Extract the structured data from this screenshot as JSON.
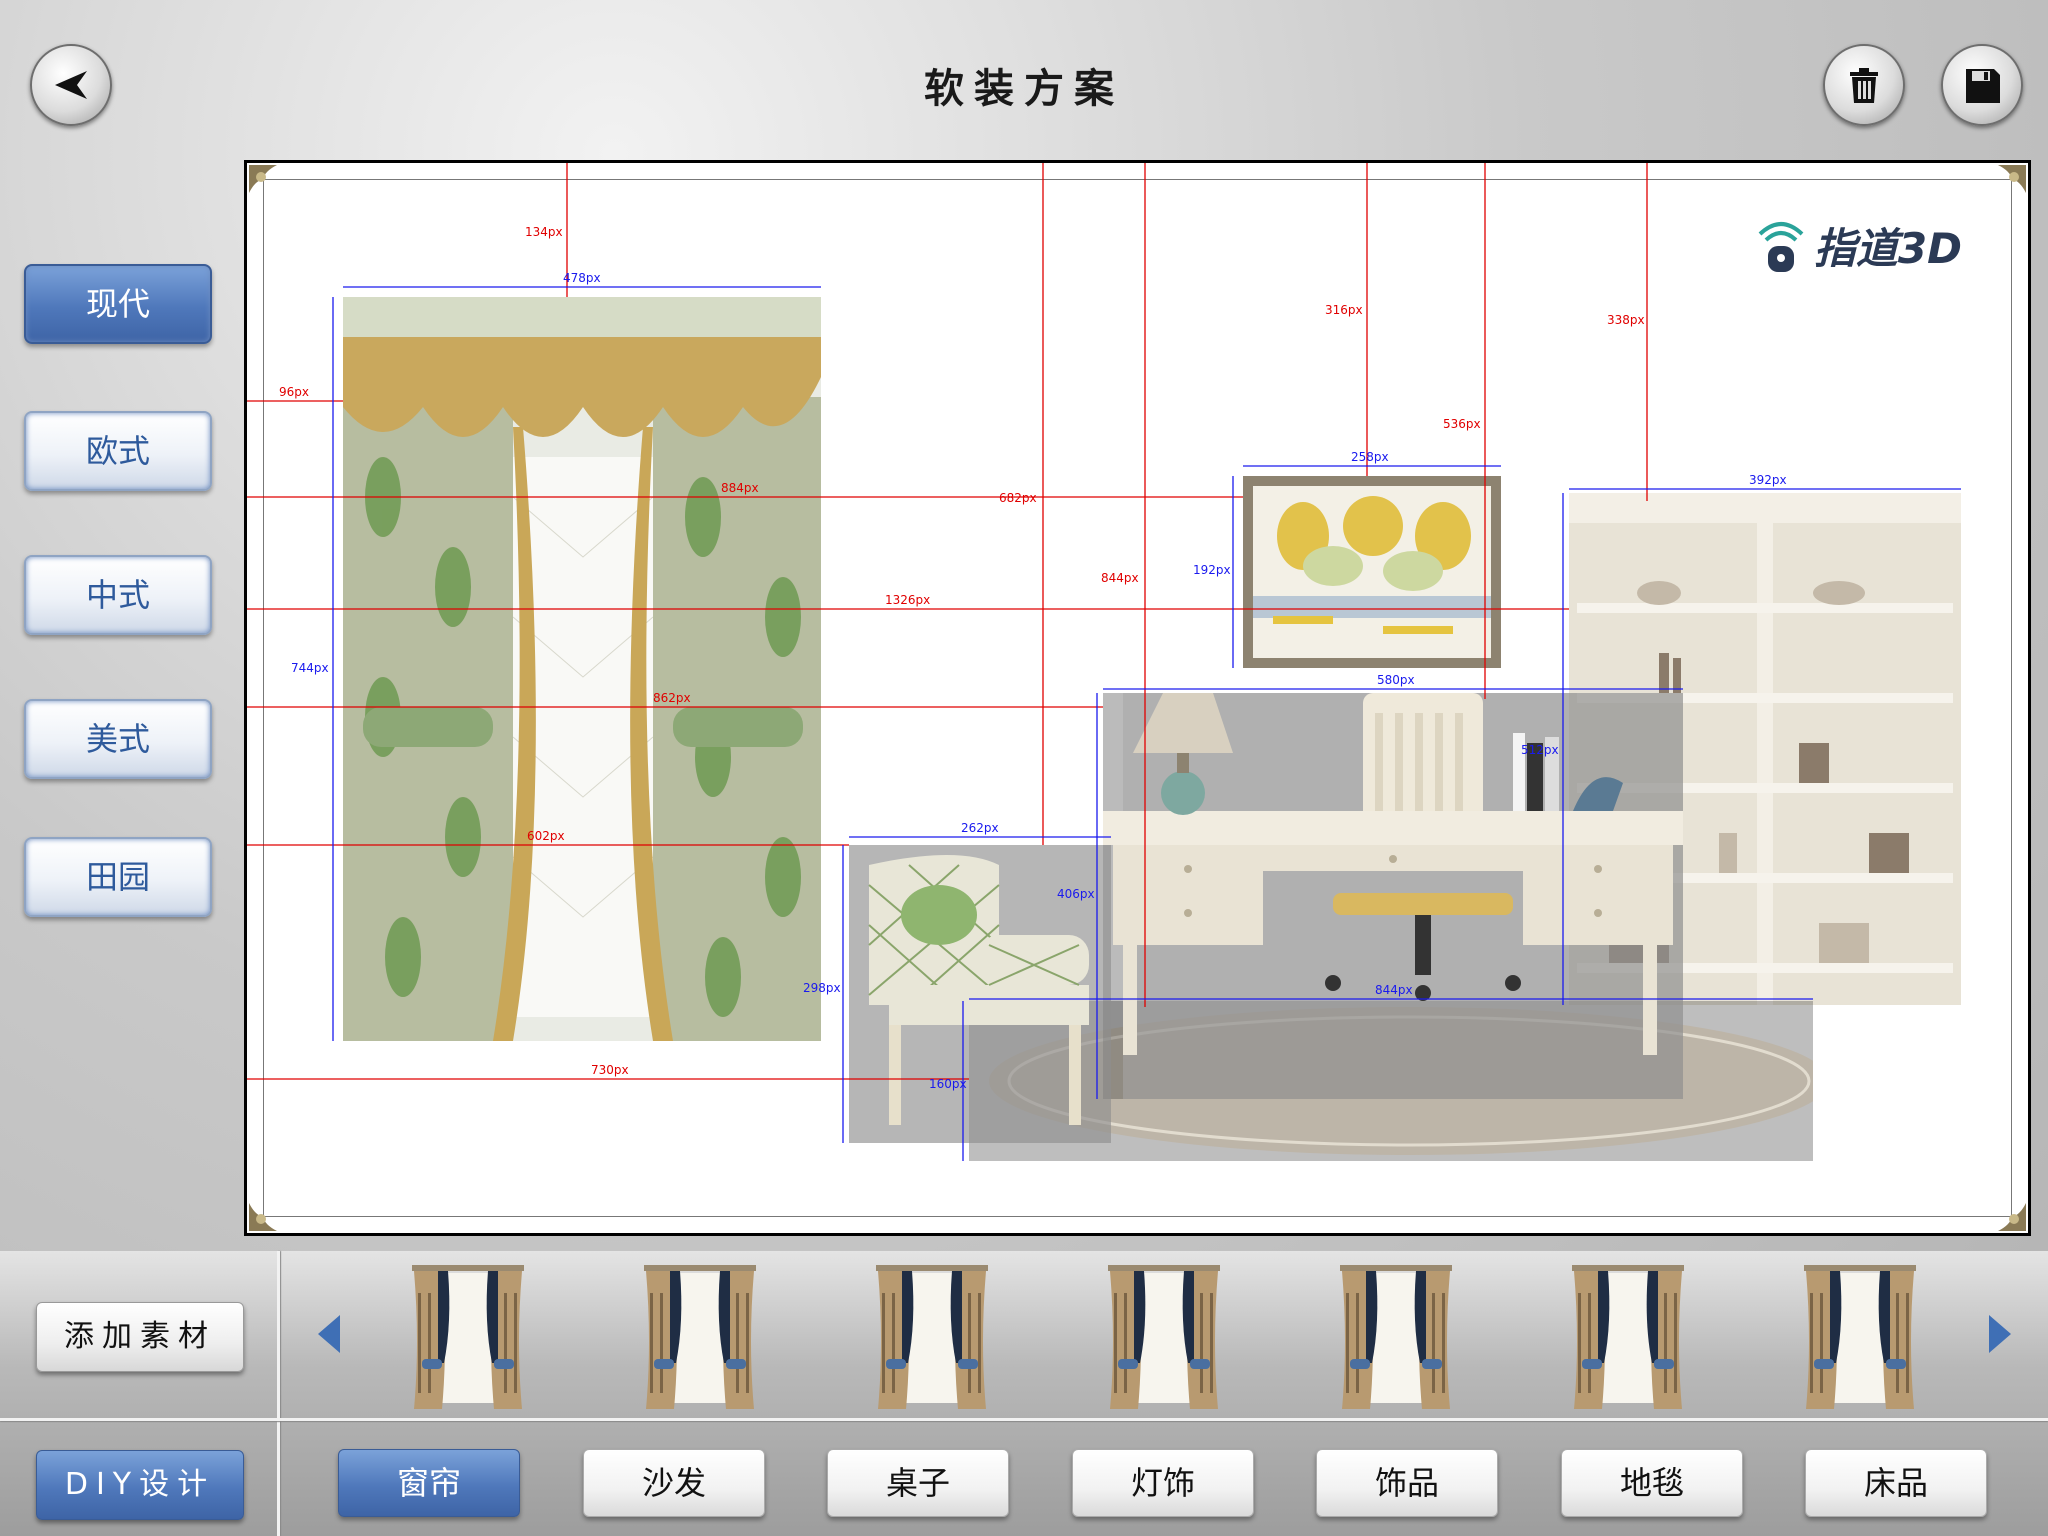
{
  "header": {
    "title": "软装方案",
    "back_icon": "back-arrow-icon",
    "trash_icon": "trash-icon",
    "save_icon": "save-disk-icon"
  },
  "styles": {
    "items": [
      "现代",
      "欧式",
      "中式",
      "美式",
      "田园"
    ],
    "selected": "现代"
  },
  "canvas": {
    "logo_text": "指道3D",
    "items": [
      "curtain",
      "armchair",
      "desk-and-chair",
      "painting",
      "bookshelf",
      "rug"
    ],
    "measurements": {
      "red": [
        "134px",
        "96px",
        "682px",
        "844px",
        "316px",
        "536px",
        "338px",
        "1326px",
        "862px",
        "602px",
        "730px",
        "884px"
      ],
      "blue": [
        "478px",
        "744px",
        "258px",
        "192px",
        "392px",
        "580px",
        "512px",
        "262px",
        "406px",
        "298px",
        "160px",
        "844px"
      ]
    }
  },
  "bottom": {
    "add_material": "添加素材",
    "diy_design": "DIY设计",
    "thumbnail_count": 7,
    "categories": [
      "窗帘",
      "沙发",
      "桌子",
      "灯饰",
      "饰品",
      "地毯",
      "床品"
    ],
    "selected_category": "窗帘"
  },
  "colors": {
    "accent_blue": "#4f78bb",
    "measure_red": "#e00000",
    "measure_blue": "#1a1aee"
  }
}
